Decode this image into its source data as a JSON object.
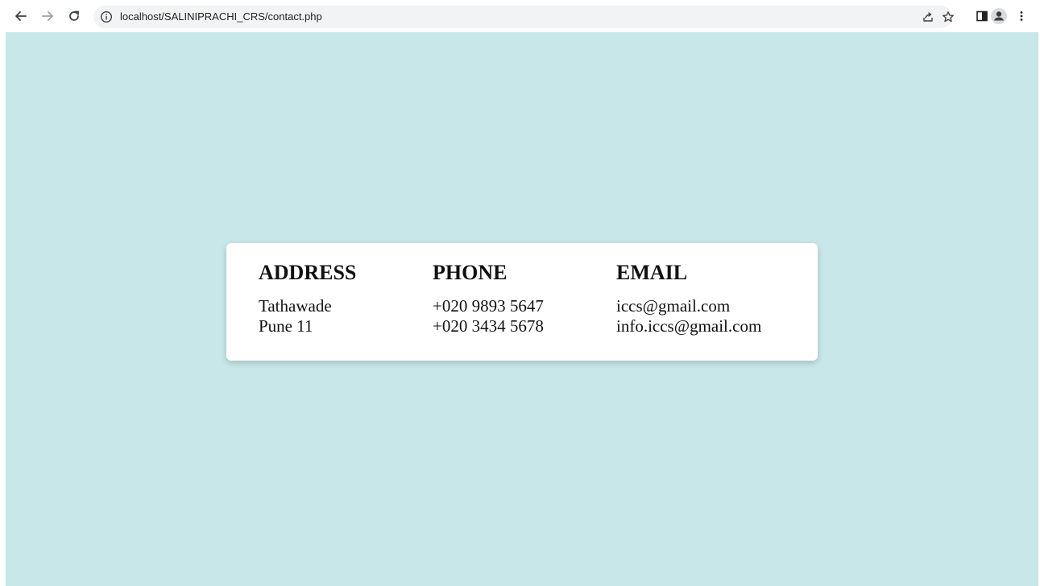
{
  "browser": {
    "url": "localhost/SALINIPRACHI_CRS/contact.php",
    "icons": {
      "back": "arrow-left-icon",
      "forward": "arrow-right-icon",
      "reload": "reload-icon",
      "info": "info-icon",
      "share": "share-icon",
      "bookmark": "star-icon",
      "sidepanel": "side-panel-icon",
      "profile": "profile-icon",
      "menu": "kebab-menu-icon"
    }
  },
  "page": {
    "background": "#c8e7e9",
    "contact": {
      "address": {
        "heading": "ADDRESS",
        "lines": [
          "Tathawade",
          "Pune 11"
        ]
      },
      "phone": {
        "heading": "PHONE",
        "lines": [
          "+020 9893 5647",
          "+020 3434 5678"
        ]
      },
      "email": {
        "heading": "EMAIL",
        "lines": [
          "iccs@gmail.com",
          "info.iccs@gmail.com"
        ]
      }
    }
  }
}
